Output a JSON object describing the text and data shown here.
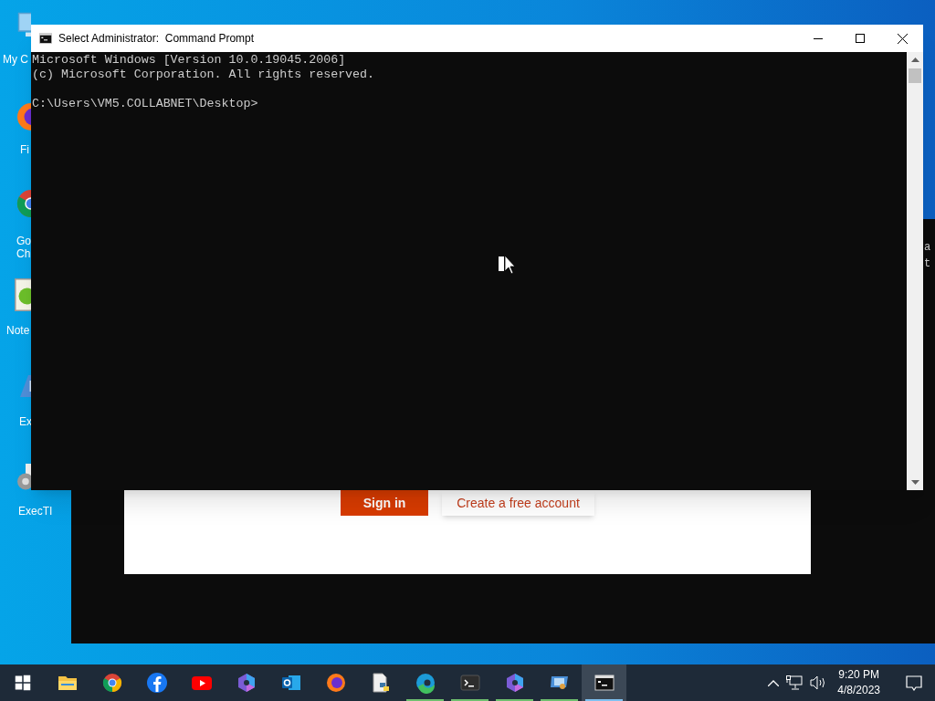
{
  "desktop_icons": [
    {
      "kind": "computer",
      "label_lines": [
        "My C"
      ]
    },
    {
      "kind": "firefox",
      "label_lines": [
        "Fi"
      ]
    },
    {
      "kind": "chrome",
      "label_lines": [
        "Go",
        "Ch"
      ]
    },
    {
      "kind": "notepad",
      "label_lines": [
        "Note"
      ]
    },
    {
      "kind": "app",
      "label_lines": [
        "Ex"
      ]
    },
    {
      "kind": "settings",
      "label_lines": [
        "ExecTI"
      ]
    }
  ],
  "background_window": {
    "text_lines": [
      "a",
      "t"
    ],
    "buttons": [
      {
        "kind": "primary",
        "label": "Sign in"
      },
      {
        "kind": "secondary",
        "label": "Create a free account"
      }
    ]
  },
  "cmd_window": {
    "title": "Select Administrator:  Command Prompt",
    "lines": [
      {
        "kind": "output",
        "text": "Microsoft Windows [Version 10.0.19045.2006]"
      },
      {
        "kind": "output",
        "text": "(c) Microsoft Corporation. All rights reserved."
      },
      {
        "kind": "prompt",
        "text": "C:\\Users\\VM5.COLLABNET\\Desktop>"
      }
    ]
  },
  "taskbar": {
    "items": [
      {
        "kind": "start",
        "running": false,
        "selected": false
      },
      {
        "kind": "explorer",
        "running": false,
        "selected": false
      },
      {
        "kind": "chrome",
        "running": false,
        "selected": false
      },
      {
        "kind": "facebook",
        "running": false,
        "selected": false
      },
      {
        "kind": "youtube",
        "running": false,
        "selected": false
      },
      {
        "kind": "hexagon",
        "running": false,
        "selected": false
      },
      {
        "kind": "outlook",
        "running": false,
        "selected": false
      },
      {
        "kind": "firefox",
        "running": false,
        "selected": false
      },
      {
        "kind": "python",
        "running": false,
        "selected": false
      },
      {
        "kind": "edge",
        "running": true,
        "selected": false
      },
      {
        "kind": "terminal",
        "running": true,
        "selected": false
      },
      {
        "kind": "hexagon",
        "running": true,
        "selected": false
      },
      {
        "kind": "remote",
        "running": true,
        "selected": false
      },
      {
        "kind": "cmd",
        "running": true,
        "selected": true
      }
    ],
    "time": "9:20 PM",
    "date": "4/8/2023"
  }
}
